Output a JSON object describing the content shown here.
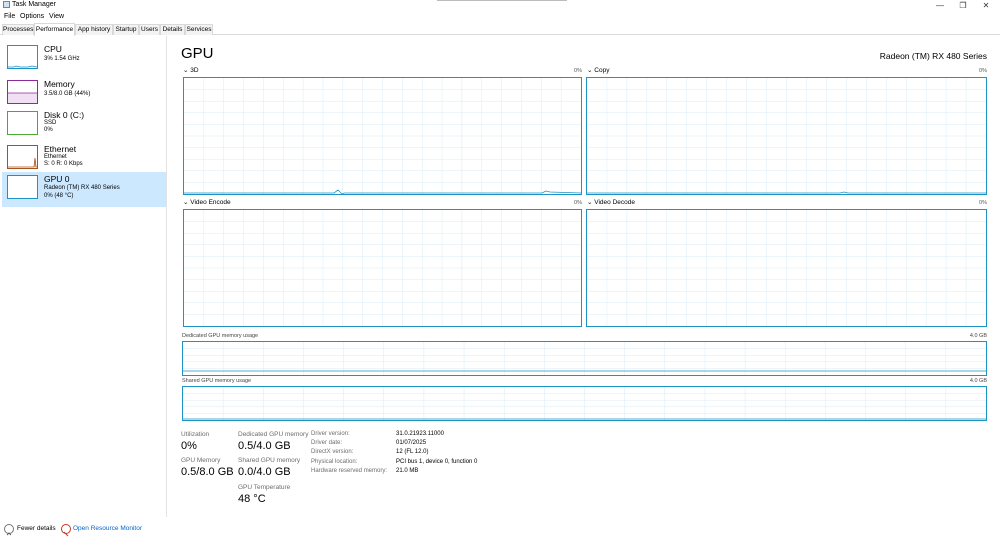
{
  "window": {
    "title": "Task Manager",
    "minimize": "—",
    "maximize": "❐",
    "close": "✕"
  },
  "menu": [
    "File",
    "Options",
    "View"
  ],
  "tabs": [
    "Processes",
    "Performance",
    "App history",
    "Startup",
    "Users",
    "Details",
    "Services"
  ],
  "active_tab": "Performance",
  "sidebar": {
    "items": [
      {
        "name": "CPU",
        "line1": "3% 1.54 GHz",
        "line2": "",
        "color": "#1c93c5"
      },
      {
        "name": "Memory",
        "line1": "3.5/8.0 GB (44%)",
        "line2": "",
        "color": "#8b2a9b"
      },
      {
        "name": "Disk 0 (C:)",
        "line1": "SSD",
        "line2": "0%",
        "color": "#4ca832"
      },
      {
        "name": "Ethernet",
        "line1": "Ethernet",
        "line2": "S: 0 R: 0 Kbps",
        "color": "#a7521c"
      },
      {
        "name": "GPU 0",
        "line1": "Radeon (TM) RX 480 Series",
        "line2": "0% (48 °C)",
        "color": "#1c93c5"
      }
    ]
  },
  "main": {
    "title": "GPU",
    "model": "Radeon (TM) RX 480 Series",
    "engines": [
      {
        "label": "3D",
        "pct": "0%"
      },
      {
        "label": "Copy",
        "pct": "0%"
      },
      {
        "label": "Video Encode",
        "pct": "0%"
      },
      {
        "label": "Video Decode",
        "pct": "0%"
      }
    ],
    "dedicated": {
      "label": "Dedicated GPU memory usage",
      "max": "4.0 GB"
    },
    "shared": {
      "label": "Shared GPU memory usage",
      "max": "4.0 GB"
    }
  },
  "stats": {
    "utilization_label": "Utilization",
    "utilization_value": "0%",
    "gpu_memory_label": "GPU Memory",
    "gpu_memory_value": "0.5/8.0 GB",
    "dedicated_label": "Dedicated GPU memory",
    "dedicated_value": "0.5/4.0 GB",
    "shared_label": "Shared GPU memory",
    "shared_value": "0.0/4.0 GB",
    "temp_label": "GPU Temperature",
    "temp_value": "48 °C"
  },
  "info": [
    {
      "label": "Driver version:",
      "value": "31.0.21923.11000"
    },
    {
      "label": "Driver date:",
      "value": "01/07/2025"
    },
    {
      "label": "DirectX version:",
      "value": "12 (FL 12.0)"
    },
    {
      "label": "Physical location:",
      "value": "PCI bus 1, device 0, function 0"
    },
    {
      "label": "Hardware reserved memory:",
      "value": "21.0 MB"
    }
  ],
  "footer": {
    "fewer_details": "Fewer details",
    "open_resmon": "Open Resource Monitor"
  },
  "colors": {
    "accent": "#1c93c5",
    "selection": "#cce8ff",
    "link": "#0066cc"
  }
}
